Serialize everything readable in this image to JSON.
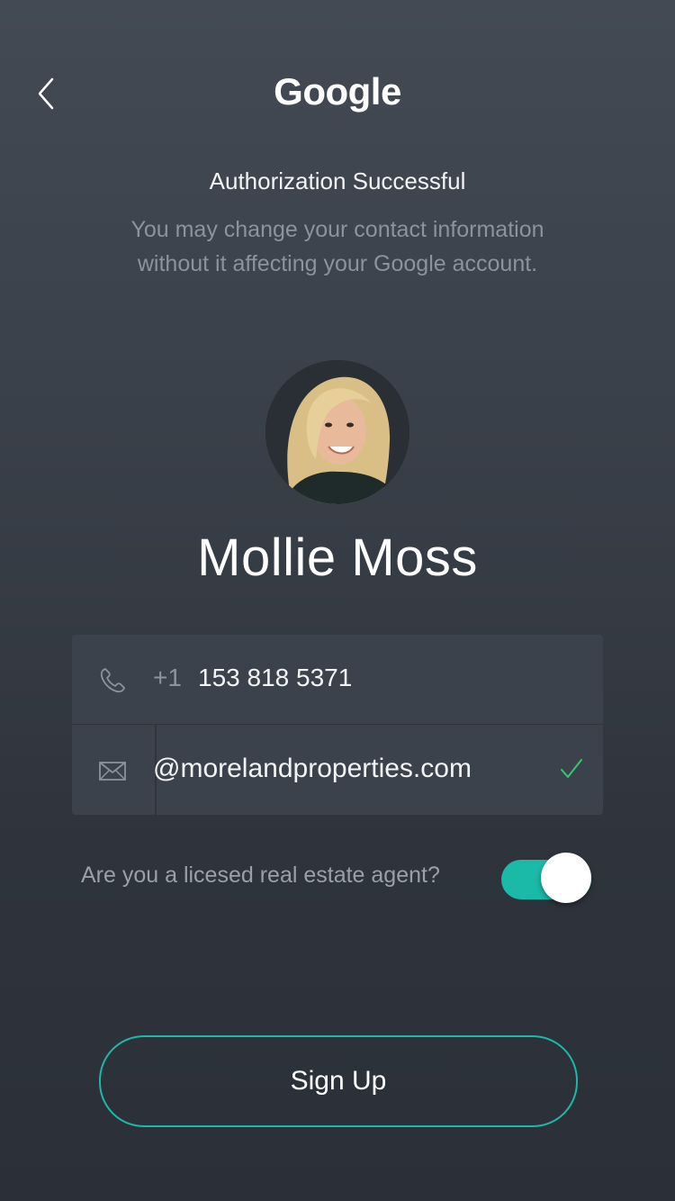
{
  "header": {
    "back_icon": "chevron-left-icon",
    "brand": "Google"
  },
  "auth": {
    "title": "Authorization Successful",
    "subtitle": "You may change your contact information without it affecting your Google account."
  },
  "profile": {
    "avatar": "user-avatar-photo",
    "name": "Mollie Moss"
  },
  "form": {
    "phone": {
      "icon": "phone-icon",
      "country_code": "+1",
      "number": "153 818 5371"
    },
    "email": {
      "icon": "mail-icon",
      "value": "@morelandproperties.com",
      "status_icon": "checkmark-icon",
      "status_color": "#2ecc71"
    }
  },
  "agent": {
    "question": "Are you a licesed real estate agent?",
    "toggle_on": true,
    "toggle_color": "#1ab9a8"
  },
  "actions": {
    "signup_label": "Sign Up"
  },
  "theme": {
    "accent": "#1ab9a8",
    "background": "#353a42"
  }
}
